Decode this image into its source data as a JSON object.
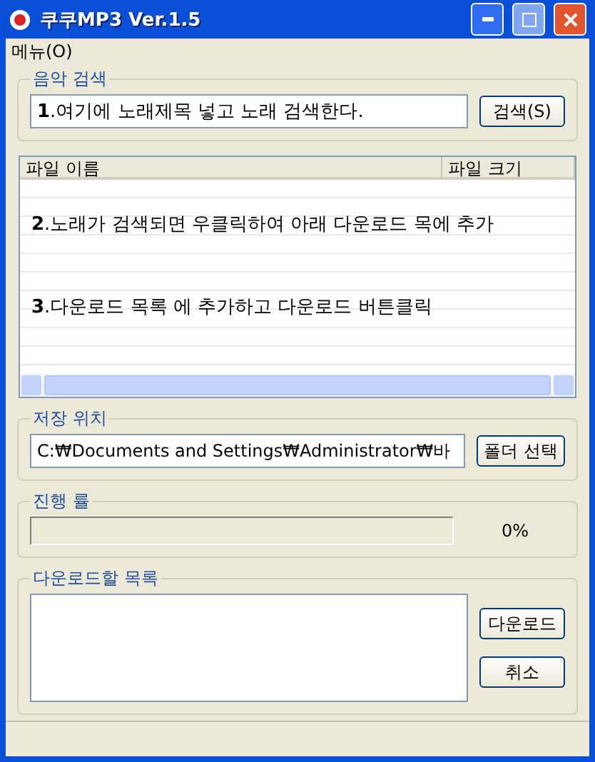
{
  "window": {
    "title": "쿠쿠MP3 Ver.1.5"
  },
  "menu": [
    "메뉴(O)"
  ],
  "search": {
    "label": "음악 검색",
    "value": "**1**.여기에 노래제목 넣고 노래 검색한다.",
    "button": "검색(S)"
  },
  "file_list": {
    "columns": [
      "파일 이름",
      "파일 크기"
    ],
    "notes": [
      "**2**.노래가 검색되면 우클릭하여 아래 다운로드 목에 추가",
      "**3**.다운로드 목록 에 추가하고 다운로드 버튼클릭"
    ]
  },
  "save": {
    "label": "저장 위치",
    "value": "C:₩Documents and Settings₩Administrator₩바",
    "button": "폴더 선택"
  },
  "progress": {
    "label": "진행 률",
    "level": 0,
    "reading": "0%"
  },
  "download": {
    "label": "다운로드할 목록",
    "buttons": [
      "다운로드",
      "취소"
    ]
  }
}
